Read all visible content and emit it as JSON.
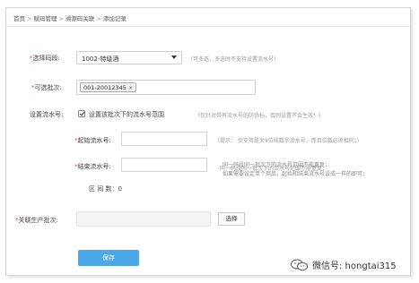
{
  "breadcrumb": {
    "items": [
      "首页",
      "赋码管理",
      "溯源码关联",
      "添加记录"
    ],
    "sep": ">"
  },
  "form": {
    "segment": {
      "required": "*",
      "label": "选择码段:",
      "value": "1002-特级酒",
      "hint": "（可多选，多选时不支持设置流水号）"
    },
    "batch": {
      "required": "*",
      "label": "可选批次:",
      "tag": "001-20012345",
      "tag_close": "×"
    },
    "serial_setting": {
      "label": "设置流水号:",
      "checkbox_label": "设置该批次下的流水号范围",
      "checked": true,
      "hint": "（仅针对带有流水号的防伪标，否则设置不会生效！）"
    },
    "start_serial": {
      "required": "*",
      "label": "起始流水号:",
      "hint": "（提示： 仅支持是大9位纯数字流水号，而且位数必须相同；）"
    },
    "end_serial": {
      "required": "*",
      "label": "结束流水号:",
      "hint_1": "同一码段同一批次下的流水号范围不能重复；",
      "hint_2": "如果需要设定单个商品，起始和结束流水号设成一样的即可；"
    },
    "interval": {
      "label": "区 间 数：",
      "value": "0"
    },
    "production_batch": {
      "required": "*",
      "label": "关联生产批次:",
      "select_button": "选择"
    },
    "save_button": "保存"
  },
  "watermark": {
    "text": "微信号: hongtai315"
  }
}
